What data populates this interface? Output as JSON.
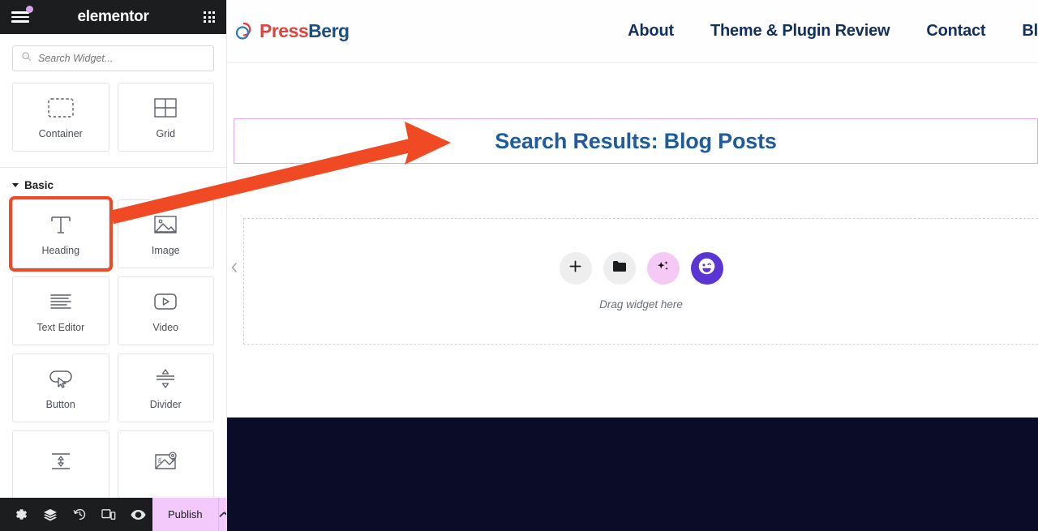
{
  "panel": {
    "brand": "elementor",
    "menu_icon": "hamburger-icon",
    "apps_icon": "grid-apps-icon",
    "search": {
      "placeholder": "Search Widget...",
      "value": "",
      "icon": "search-icon"
    },
    "top_widgets": [
      {
        "label": "Container",
        "icon": "container-icon"
      },
      {
        "label": "Grid",
        "icon": "grid-layout-icon"
      }
    ],
    "section": {
      "title": "Basic",
      "expanded": true,
      "caret": "caret-down-icon"
    },
    "basic_widgets": [
      {
        "label": "Heading",
        "icon": "heading-t-icon",
        "highlighted": true
      },
      {
        "label": "Image",
        "icon": "image-icon",
        "highlighted": false
      },
      {
        "label": "Text Editor",
        "icon": "text-editor-icon",
        "highlighted": false
      },
      {
        "label": "Video",
        "icon": "video-play-icon",
        "highlighted": false
      },
      {
        "label": "Button",
        "icon": "button-cursor-icon",
        "highlighted": false
      },
      {
        "label": "Divider",
        "icon": "divider-icon",
        "highlighted": false
      },
      {
        "label": "",
        "icon": "spacer-icon",
        "highlighted": false
      },
      {
        "label": "",
        "icon": "google-maps-icon",
        "highlighted": false
      }
    ],
    "footer": {
      "icons": [
        {
          "name": "settings-gear-icon"
        },
        {
          "name": "navigator-layers-icon"
        },
        {
          "name": "history-icon"
        },
        {
          "name": "responsive-mode-icon"
        },
        {
          "name": "preview-eye-icon"
        }
      ],
      "publish_label": "Publish",
      "publish_arrow_icon": "chevron-up-icon"
    }
  },
  "canvas": {
    "site": {
      "logo": {
        "name_part1": "Press",
        "name_part2": "Berg",
        "mark": "pressberg-logo-mark"
      },
      "nav": [
        {
          "label": "About"
        },
        {
          "label": "Theme & Plugin Review"
        },
        {
          "label": "Contact"
        },
        {
          "label": "Bl"
        }
      ]
    },
    "heading_widget": {
      "text": "Search Results: Blog Posts"
    },
    "dropzone": {
      "label": "Drag widget here",
      "buttons": [
        {
          "name": "add-element-button",
          "icon": "plus-icon"
        },
        {
          "name": "add-template-button",
          "icon": "folder-icon"
        },
        {
          "name": "ai-button",
          "icon": "sparkles-icon"
        },
        {
          "name": "avatar-button",
          "icon": "winking-face-icon"
        }
      ]
    },
    "collapse_handle_icon": "chevron-left-icon"
  },
  "annotation": {
    "arrow_color": "#ef4a23",
    "highlight_color": "#ef4a23"
  },
  "colors": {
    "panel_header_bg": "#1b1d1f",
    "publish_bg": "#f3c9fb",
    "heading_text": "#1f5c9e",
    "nav_text": "#12305c",
    "footer_bg": "#0b0d28",
    "widget_border_highlight": "#ddaae6"
  }
}
